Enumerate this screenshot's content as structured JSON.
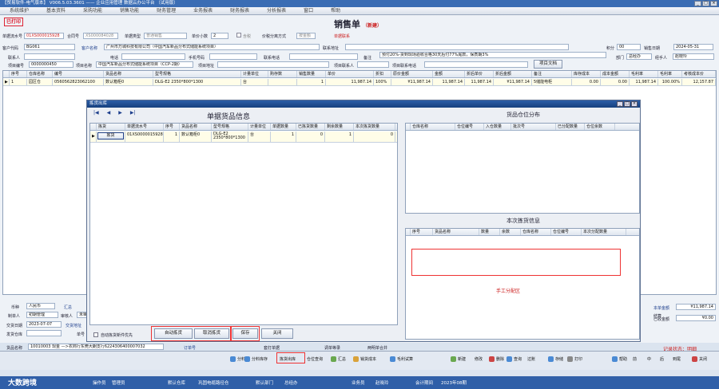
{
  "window": {
    "title": "【贸易软件-电气版本】 V006.5.03.3601 —— 企业应用管理 数据云办公平台 （试用版）"
  },
  "menu": [
    "系统维护",
    "基本资料",
    "采购功能",
    "销售功能",
    "财务管理",
    "业务报表",
    "财务报表",
    "分析报表",
    "窗口",
    "帮助"
  ],
  "form": {
    "stamp": "已打印",
    "title": "销售单",
    "title_sub": "（新建）",
    "order_no_label": "单据流水号",
    "order_no": "01XS000015928",
    "prev_no_label": "合同号",
    "prev_no": "XS000084028",
    "doc_type_label": "单据类型",
    "doc_type": "普通销售",
    "unit_decimals_label": "单价小数",
    "unit_decimals": "2",
    "tax_label": "含税",
    "price_mode_label": "价税分离方式",
    "price_mode": "按金额",
    "buyer_label": "单据联系",
    "code_label": "客户代码",
    "code": "BG061",
    "customer_label": "客户名称",
    "customer": "广州市万城科技有限公司（中国汽车新品分布式储能系统项目）",
    "address_label": "联系地址",
    "credit_label": "积分",
    "credit": "00",
    "date_label": "销售日期",
    "date": "2024-05-31",
    "contact_label": "联系人",
    "phone_label": "电话",
    "mobile_label": "手机号码",
    "email_label": "联系电话",
    "remark_label": "备注",
    "remark": "预付20%-货到现场验收合格30天后付77%尾款，保质期3%",
    "dept_label": "部门",
    "dept": "总经办",
    "agent_label": "经手人",
    "agent": "赵晓玲",
    "project_no_label": "项目编号",
    "project_no": "0000000450",
    "project_name_label": "项目名称",
    "project_name": "中国汽车新品分布式储能系统项目（CCP-2期）",
    "project_addr_label": "项目地址",
    "project_contact_label": "项目联系人",
    "project_phone_label": "项目联系电话",
    "project_doc_btn": "项目文档"
  },
  "main_grid": {
    "headers": [
      "序号",
      "仓库名称",
      "编号",
      "货品名称",
      "型号规格",
      "计量单位",
      "购存数",
      "销售数量",
      "单价",
      "折扣",
      "原价金额",
      "金额",
      "折后单价",
      "折后金额",
      "备注",
      "库存成本",
      "成本金额",
      "毛利率",
      "毛利率",
      "考核成本价"
    ],
    "row": [
      "1",
      "园区仓",
      "0560562823062100",
      "数认箱柜0",
      "DLG-E2 2350*800*1300",
      "台",
      "",
      "1",
      "11,987.14",
      "100%",
      "¥11,987.14",
      "11,987.14",
      "11,987.14",
      "¥11,987.14",
      "5储能电柜",
      "0.00",
      "0.00",
      "11,987.14",
      "100.00%",
      "12,157.87"
    ]
  },
  "left_footer": {
    "currency_label": "币种",
    "currency": "人民币",
    "summary_label": "汇总",
    "maker_label": "制单人",
    "maker": "初期管理",
    "auditor_label": "审核人",
    "auditor": "未审核",
    "date_label": "交货日期",
    "date": "2023-07-07",
    "settle_label": "交货地址",
    "settle": "",
    "warehouse_label": "发货仓库",
    "warehouse": "",
    "doc_label": "单号"
  },
  "right_footer": {
    "amount_label": "本单金额",
    "amount": "¥11,987.14",
    "discount_label": "结算",
    "discount": "",
    "received_label": "已收金额",
    "received": "¥0.00"
  },
  "bottom_info": {
    "acct_label": "货品名称",
    "acct": "10010003 现金 —>农商行东莞大朗支行6224306400007032",
    "order_btn": "订单号",
    "print_label": "套打单据",
    "link_label": "调单等录",
    "merge_label": "两明单合并",
    "record_state": "记录状态：明细"
  },
  "dialog": {
    "title": "拣货出库",
    "left_title": "单据货品信息",
    "left_headers": [
      "拣货",
      "单据流水号",
      "序号",
      "货品名称",
      "型号规格",
      "计量单位",
      "单据数量",
      "已拣货数量",
      "剩余数量",
      "本次拣货数量"
    ],
    "left_row": {
      "pick_btn": "拣货",
      "no": "01XS0000015928",
      "seq": "1",
      "name": "数认箱柜0",
      "spec": "DLG-E2 2350*800*1300",
      "unit": "台",
      "qty": "1",
      "picked": "0",
      "remain": "1",
      "current": "0"
    },
    "right_top_title": "货品仓位分布",
    "right_top_headers": [
      "仓库名称",
      "仓位编号",
      "入仓数量",
      "批次号",
      "已分配数量",
      "仓位余数"
    ],
    "right_bottom_title": "本次拣货信息",
    "right_bottom_headers": [
      "序号",
      "货品名称",
      "数量",
      "余数",
      "仓库名称",
      "仓位编号",
      "本次分配数量"
    ],
    "manual_label": "手工分配区",
    "auto_check_label": "自动拣货新件优先",
    "buttons": {
      "auto": "自动拣货",
      "cancel": "取消拣货",
      "save": "保存",
      "close": "关闭"
    }
  },
  "bottom_toolbar": [
    "分料",
    "分料库存",
    "拣货出库",
    "仓位查询",
    "汇总",
    "销货成本",
    "毛利试算",
    "新建",
    "修改",
    "删除",
    "查询",
    "过账",
    "存储",
    "打印",
    "帮助",
    "前",
    "中",
    "后",
    "到尾",
    "关闭"
  ],
  "status": {
    "user_label": "操作员",
    "user": "管理员",
    "dept_label": "默认仓库",
    "dept": "巩固电缆路径仓",
    "sub_label": "默认部门",
    "sub": "总经办",
    "op_label": "业务员",
    "op": "赵晓玲",
    "period_label": "会计期间",
    "period": "2023年08期",
    "brand": "大数跨境"
  },
  "colors": {
    "titlebar": "#3b6db4",
    "highlight": "#e33333",
    "manual": "#e33333"
  }
}
